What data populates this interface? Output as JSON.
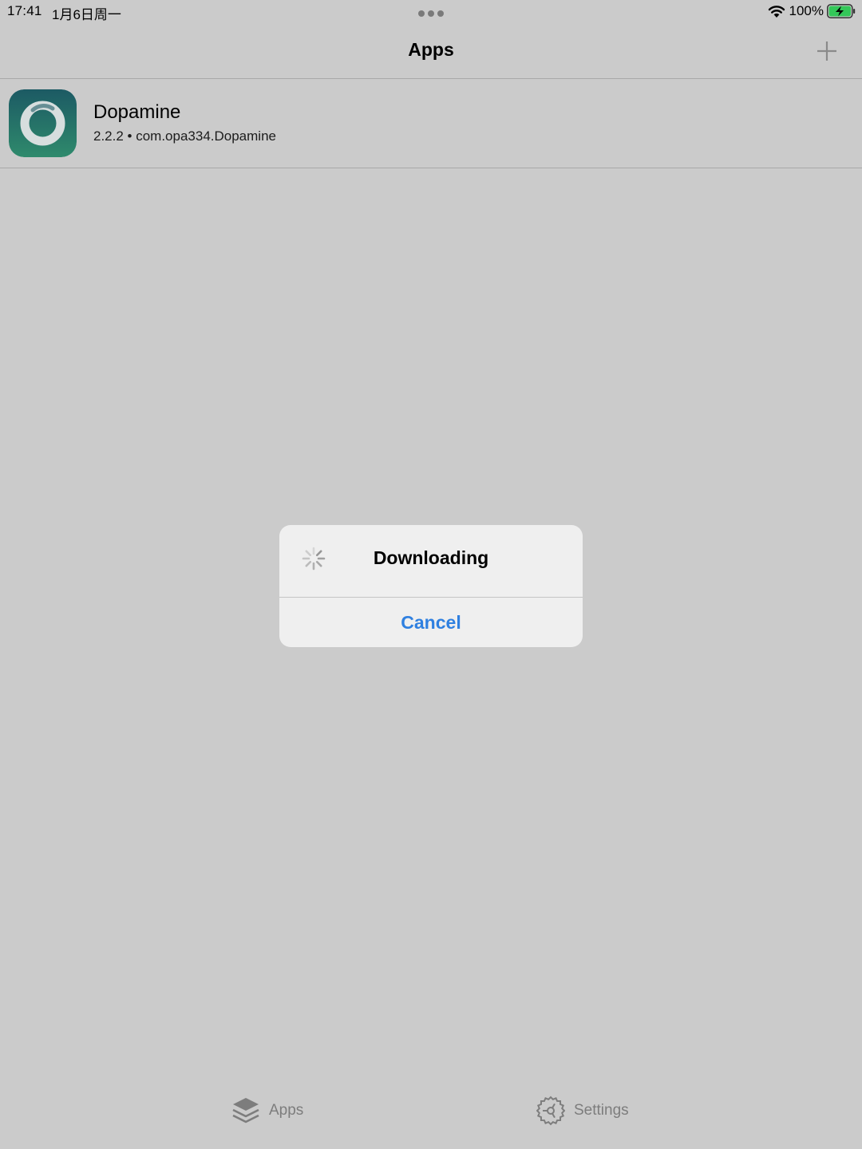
{
  "status_bar": {
    "time": "17:41",
    "date": "1月6日周一",
    "battery_percent": "100%",
    "battery_level": 1.0,
    "icons": [
      "wifi-icon",
      "battery-charging-icon"
    ]
  },
  "nav": {
    "title": "Apps",
    "add_icon": "plus-icon"
  },
  "apps": [
    {
      "name": "Dopamine",
      "version": "2.2.2",
      "separator": "•",
      "bundle_id": "com.opa334.Dopamine",
      "meta": "2.2.2 • com.opa334.Dopamine",
      "icon": "dopamine-app-icon"
    }
  ],
  "alert": {
    "title": "Downloading",
    "cancel_label": "Cancel",
    "icon": "spinner-icon"
  },
  "tab_bar": {
    "items": [
      {
        "label": "Apps",
        "icon": "stack-icon"
      },
      {
        "label": "Settings",
        "icon": "gear-icon"
      }
    ]
  },
  "colors": {
    "background": "#cbcbcb",
    "accent": "#2f80e0",
    "alert_background": "#efefef",
    "tab_inactive": "#7d7d7d",
    "battery_fill": "#34c759"
  }
}
